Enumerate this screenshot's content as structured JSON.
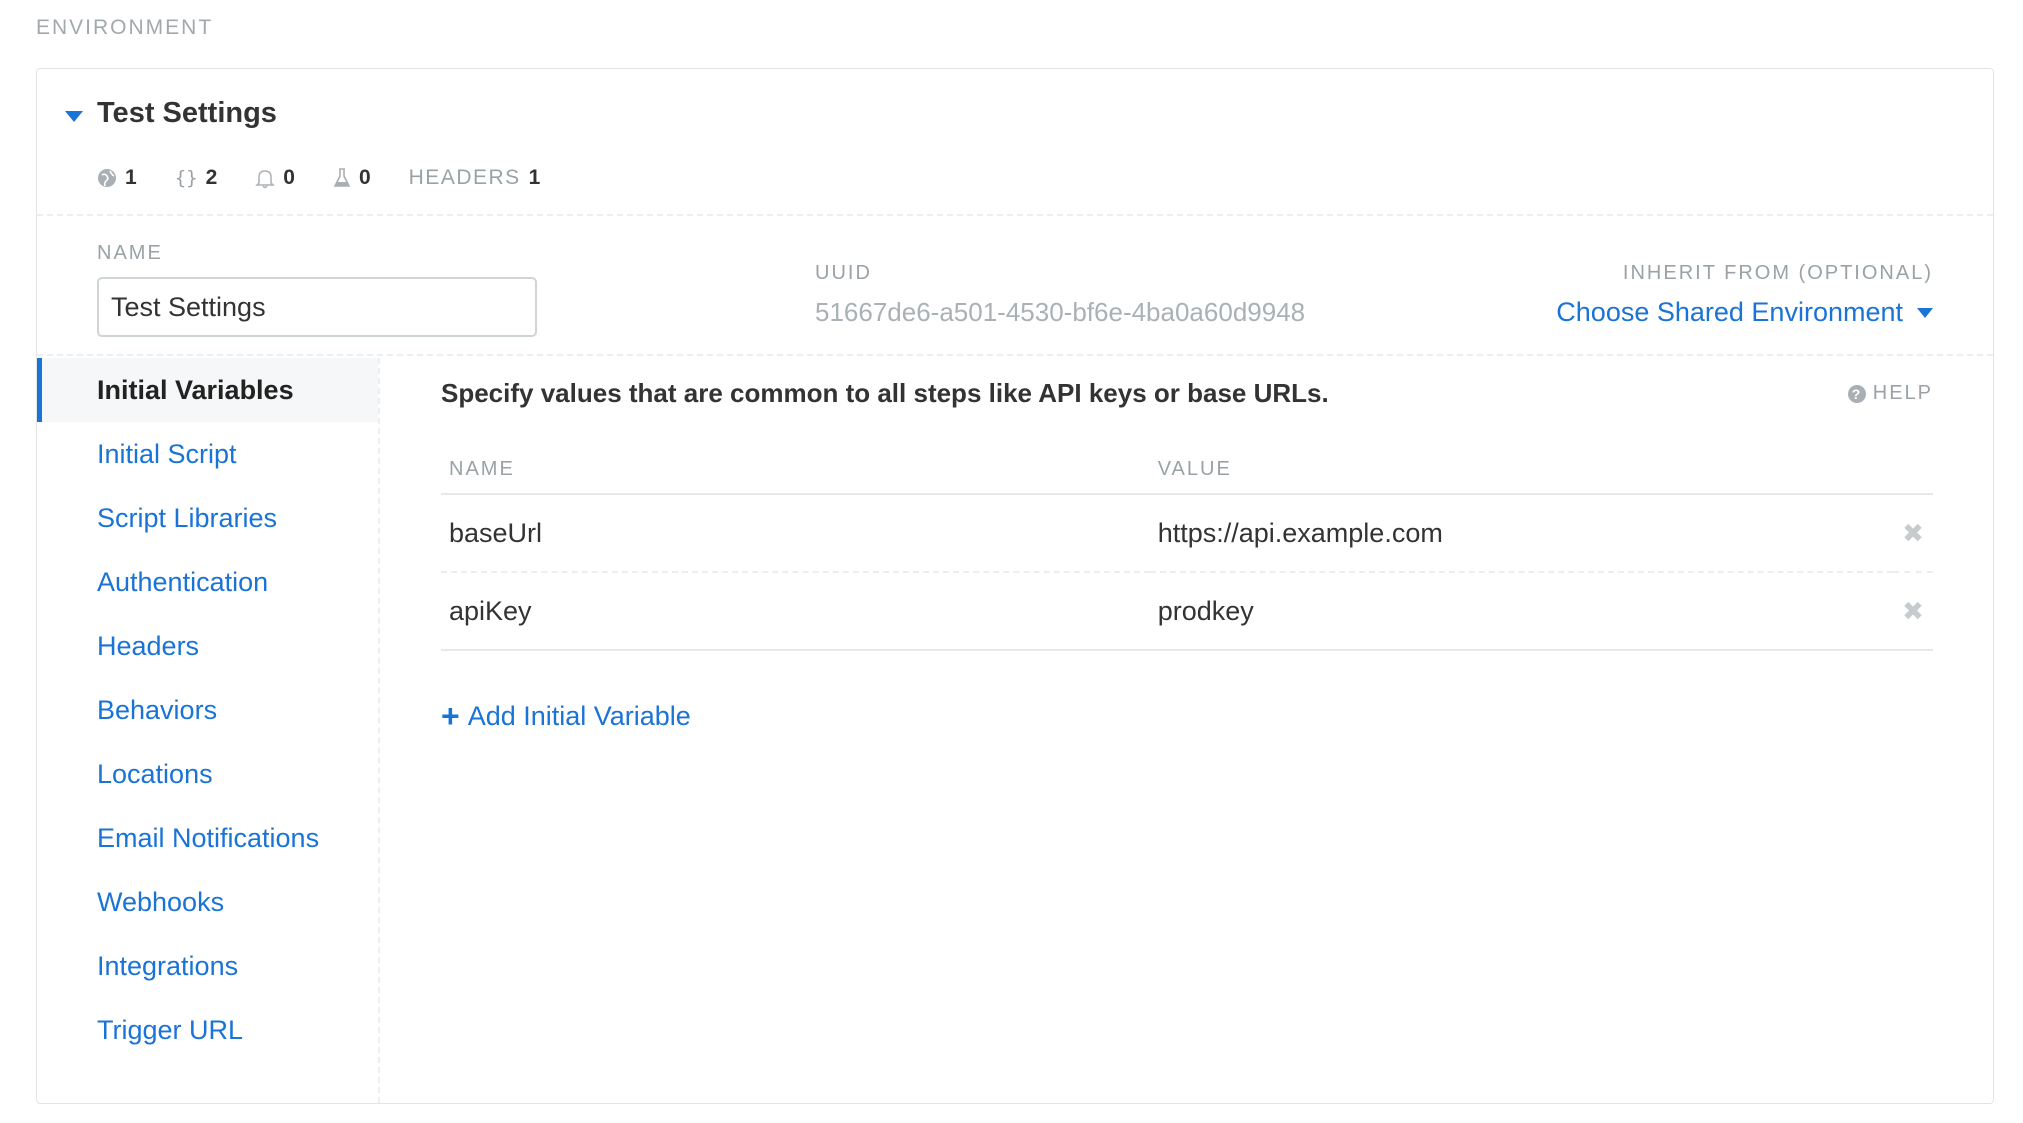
{
  "section_label": "ENVIRONMENT",
  "card": {
    "title": "Test Settings",
    "stats": [
      {
        "icon": "globe-icon",
        "value": "1"
      },
      {
        "icon": "braces-icon",
        "value": "2"
      },
      {
        "icon": "bell-icon",
        "value": "0"
      },
      {
        "icon": "flask-icon",
        "value": "0"
      }
    ],
    "headers_label": "HEADERS",
    "headers_count": "1"
  },
  "meta": {
    "name_label": "NAME",
    "name_value": "Test Settings",
    "uuid_label": "UUID",
    "uuid_value": "51667de6-a501-4530-bf6e-4ba0a60d9948",
    "inherit_label": "INHERIT FROM (OPTIONAL)",
    "inherit_value": "Choose Shared Environment"
  },
  "sidebar": {
    "items": [
      {
        "label": "Initial Variables",
        "active": true
      },
      {
        "label": "Initial Script"
      },
      {
        "label": "Script Libraries"
      },
      {
        "label": "Authentication"
      },
      {
        "label": "Headers"
      },
      {
        "label": "Behaviors"
      },
      {
        "label": "Locations"
      },
      {
        "label": "Email Notifications"
      },
      {
        "label": "Webhooks"
      },
      {
        "label": "Integrations"
      },
      {
        "label": "Trigger URL"
      }
    ]
  },
  "main": {
    "description": "Specify values that are common to all steps like API keys or base URLs.",
    "help_label": "HELP",
    "columns": [
      "NAME",
      "VALUE"
    ],
    "rows": [
      {
        "name": "baseUrl",
        "value": "https://api.example.com"
      },
      {
        "name": "apiKey",
        "value": "prodkey"
      }
    ],
    "add_label": "Add Initial Variable"
  },
  "colors": {
    "accent": "#1a73d6",
    "muted": "#9aa2a8"
  }
}
